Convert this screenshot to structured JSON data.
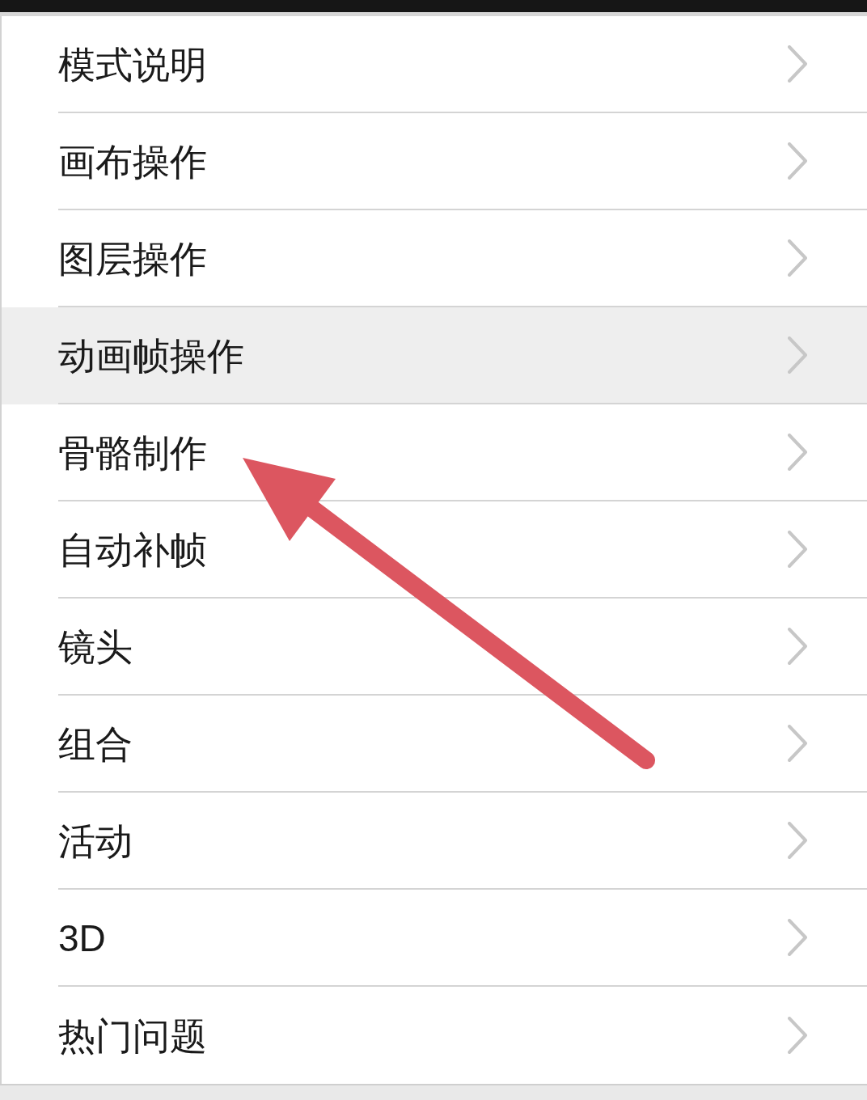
{
  "menu_items": [
    {
      "label": "模式说明",
      "selected": false
    },
    {
      "label": "画布操作",
      "selected": false
    },
    {
      "label": "图层操作",
      "selected": false
    },
    {
      "label": "动画帧操作",
      "selected": true
    },
    {
      "label": "骨骼制作",
      "selected": false
    },
    {
      "label": "自动补帧",
      "selected": false
    },
    {
      "label": "镜头",
      "selected": false
    },
    {
      "label": "组合",
      "selected": false
    },
    {
      "label": "活动",
      "selected": false
    },
    {
      "label": "3D",
      "selected": false
    },
    {
      "label": "热门问题",
      "selected": false
    }
  ]
}
